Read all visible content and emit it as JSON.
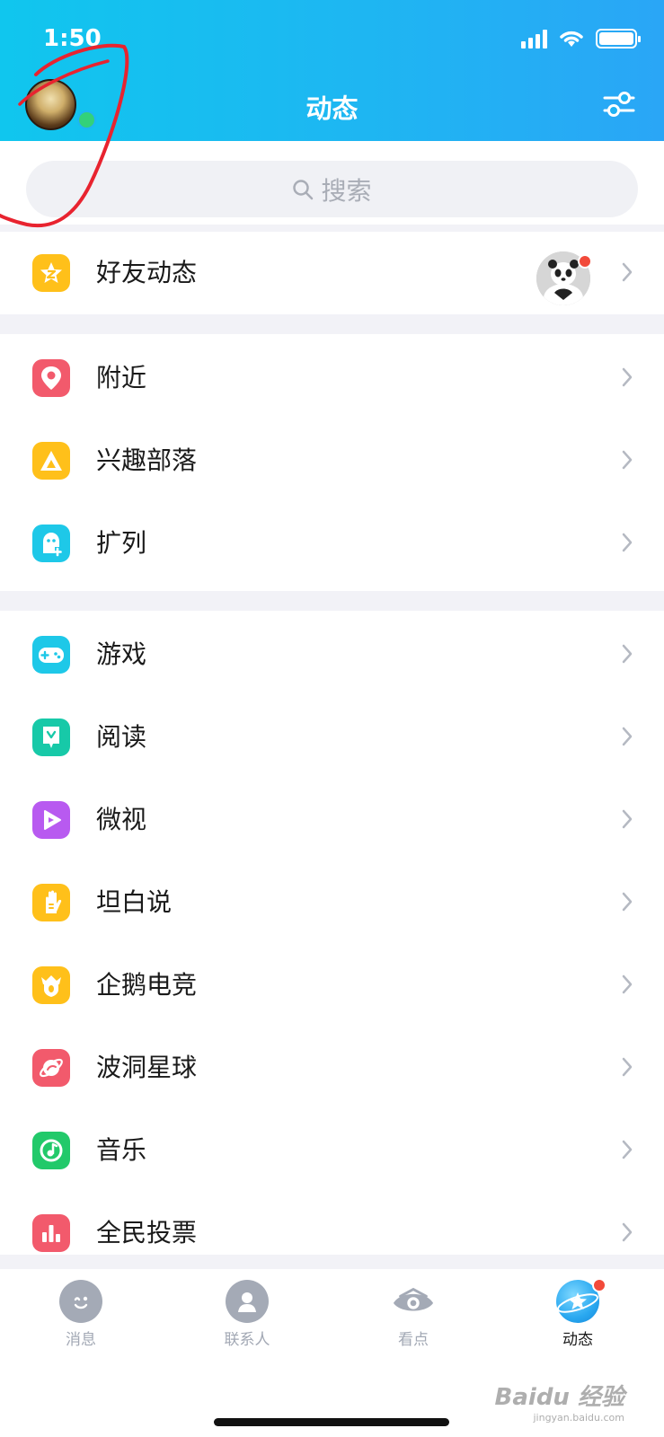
{
  "status": {
    "time": "1:50"
  },
  "header": {
    "title": "动态"
  },
  "search": {
    "placeholder": "搜索"
  },
  "friend_feed": {
    "label": "好友动态"
  },
  "group1": [
    {
      "label": "附近",
      "icon": "location-pin-icon",
      "color": "#f25a6c"
    },
    {
      "label": "兴趣部落",
      "icon": "tent-icon",
      "color": "#ffc01a"
    },
    {
      "label": "扩列",
      "icon": "ghost-plus-icon",
      "color": "#1ec8e8"
    }
  ],
  "group2": [
    {
      "label": "游戏",
      "icon": "gamepad-icon",
      "color": "#1ec8e8"
    },
    {
      "label": "阅读",
      "icon": "book-icon",
      "color": "#17c9a8"
    },
    {
      "label": "微视",
      "icon": "play-icon",
      "color": "#b85af0"
    },
    {
      "label": "坦白说",
      "icon": "hand-icon",
      "color": "#ffc01a"
    },
    {
      "label": "企鹅电竞",
      "icon": "crown-shield-icon",
      "color": "#ffc01a"
    },
    {
      "label": "波洞星球",
      "icon": "planet-icon",
      "color": "#f25a6c"
    },
    {
      "label": "音乐",
      "icon": "music-icon",
      "color": "#22c96a"
    },
    {
      "label": "全民投票",
      "icon": "bar-chart-icon",
      "color": "#f25a6c"
    }
  ],
  "tabs": [
    {
      "label": "消息",
      "icon": "message-face-icon"
    },
    {
      "label": "联系人",
      "icon": "contact-person-icon"
    },
    {
      "label": "看点",
      "icon": "eye-icon"
    },
    {
      "label": "动态",
      "icon": "star-planet-icon",
      "active": true
    }
  ],
  "watermark": {
    "main": "Baidu 经验",
    "sub": "jingyan.baidu.com"
  }
}
